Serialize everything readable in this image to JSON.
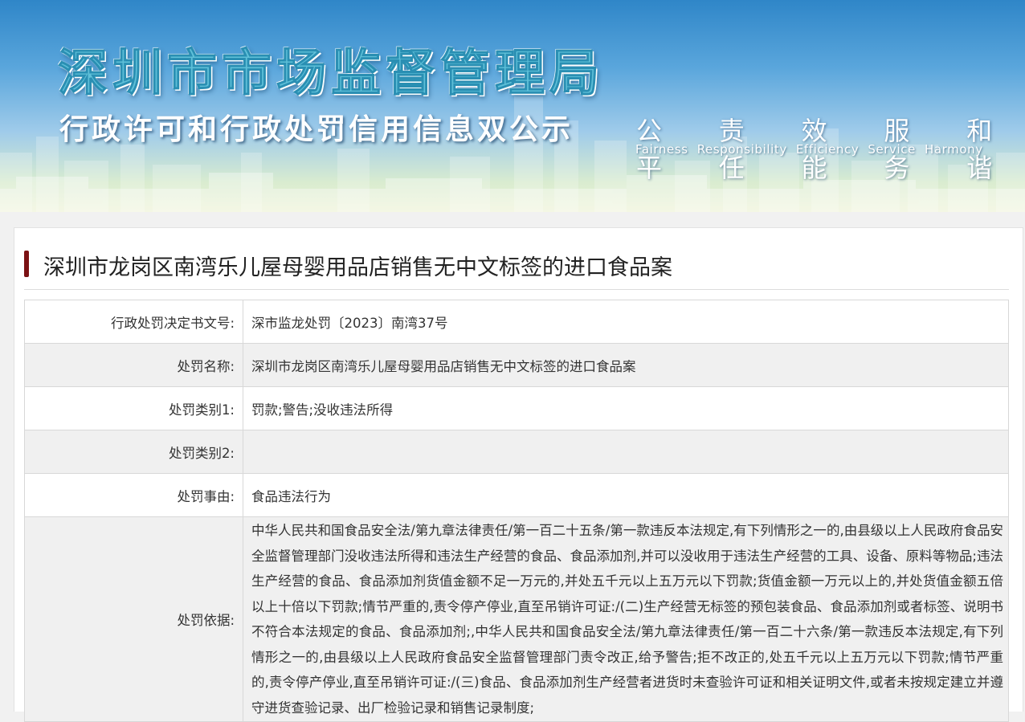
{
  "banner": {
    "title": "深圳市市场监督管理局",
    "subtitle": "行政许可和行政处罚信用信息双公示",
    "slogan_cn": [
      "公平",
      "责任",
      "效能",
      "服务",
      "和谐"
    ],
    "slogan_en": [
      "Fairness",
      "Responsibility",
      "Efficiency",
      "Service",
      "Harmony"
    ]
  },
  "case": {
    "title": "深圳市龙岗区南湾乐儿屋母婴用品店销售无中文标签的进口食品案"
  },
  "table": {
    "rows": [
      {
        "label": "行政处罚决定书文号:",
        "value": "深市监龙处罚〔2023〕南湾37号"
      },
      {
        "label": "处罚名称:",
        "value": "深圳市龙岗区南湾乐儿屋母婴用品店销售无中文标签的进口食品案"
      },
      {
        "label": "处罚类别1:",
        "value": "罚款;警告;没收违法所得"
      },
      {
        "label": "处罚类别2:",
        "value": ""
      },
      {
        "label": "处罚事由:",
        "value": "食品违法行为"
      },
      {
        "label": "处罚依据:",
        "value": "中华人民共和国食品安全法/第九章法律责任/第一百二十五条/第一款违反本法规定,有下列情形之一的,由县级以上人民政府食品安全监督管理部门没收违法所得和违法生产经营的食品、食品添加剂,并可以没收用于违法生产经营的工具、设备、原料等物品;违法生产经营的食品、食品添加剂货值金额不足一万元的,并处五千元以上五万元以下罚款;货值金额一万元以上的,并处货值金额五倍以上十倍以下罚款;情节严重的,责令停产停业,直至吊销许可证:/(二)生产经营无标签的预包装食品、食品添加剂或者标签、说明书不符合本法规定的食品、食品添加剂;,中华人民共和国食品安全法/第九章法律责任/第一百二十六条/第一款违反本法规定,有下列情形之一的,由县级以上人民政府食品安全监督管理部门责令改正,给予警告;拒不改正的,处五千元以上五万元以下罚款;情节严重的,责令停产停业,直至吊销许可证:/(三)食品、食品添加剂生产经营者进货时未查验许可证和相关证明文件,或者未按规定建立并遵守进货查验记录、出厂检验记录和销售记录制度;"
      }
    ]
  }
}
